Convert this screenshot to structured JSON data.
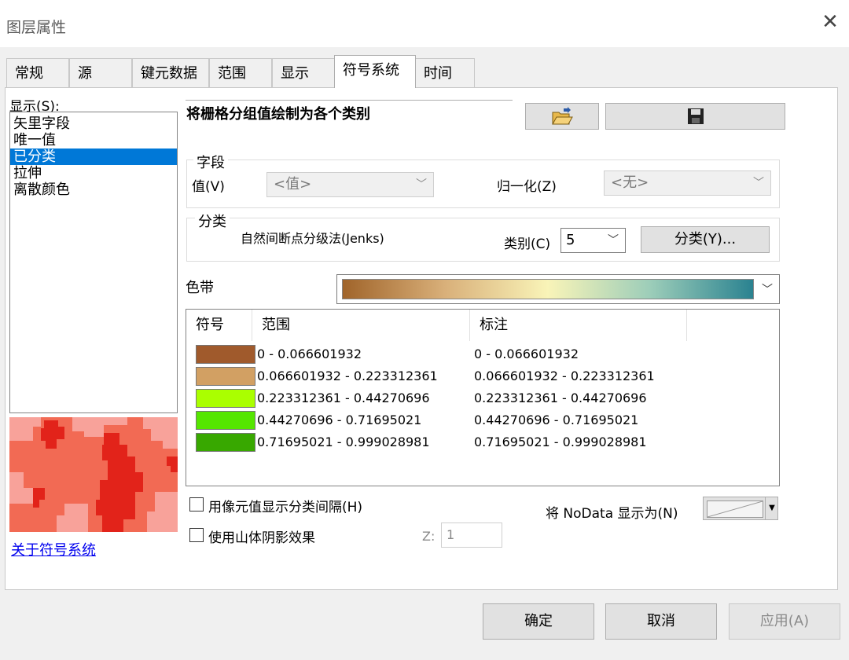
{
  "window": {
    "title": "图层属性"
  },
  "tabs": [
    {
      "label": "常规"
    },
    {
      "label": "源"
    },
    {
      "label": "键元数据"
    },
    {
      "label": "范围"
    },
    {
      "label": "显示"
    },
    {
      "label": "符号系统"
    },
    {
      "label": "时间"
    }
  ],
  "left": {
    "show_label": "显示(S):",
    "items": [
      {
        "label": "矢里字段"
      },
      {
        "label": "唯一值"
      },
      {
        "label": "已分类"
      },
      {
        "label": "拉伸"
      },
      {
        "label": "离散颜色"
      }
    ],
    "selected_index": 2,
    "about_link": "关于符号系统"
  },
  "main": {
    "heading": "将栅格分组值绘制为各个类别",
    "open_icon": "folder-open-icon",
    "save_icon": "floppy-disk-icon",
    "field_group": {
      "title": "字段",
      "value_label": "值(V)",
      "value_selected": "<值>",
      "normalize_label": "归一化(Z)",
      "normalize_selected": "<无>"
    },
    "classify_group": {
      "title": "分类",
      "method": "自然间断点分级法(Jenks)",
      "classes_label": "类别(C)",
      "classes_value": "5",
      "classify_button": "分类(Y)..."
    },
    "color_ramp": {
      "label": "色带",
      "colors": [
        "#a0642a",
        "#d9b07a",
        "#f9f4b8",
        "#9ccdb9",
        "#2a8290"
      ]
    },
    "table": {
      "headers": [
        "符号",
        "范围",
        "标注"
      ],
      "rows": [
        {
          "color": "#a05a2c",
          "range": "0 - 0.066601932",
          "label": "0 - 0.066601932"
        },
        {
          "color": "#d2a063",
          "range": "0.066601932 - 0.223312361",
          "label": "0.066601932 - 0.223312361"
        },
        {
          "color": "#aaff00",
          "range": "0.223312361 - 0.44270696",
          "label": "0.223312361 - 0.44270696"
        },
        {
          "color": "#55e600",
          "range": "0.44270696 - 0.71695021",
          "label": "0.44270696 - 0.71695021"
        },
        {
          "color": "#38a800",
          "range": "0.71695021 - 0.999028981",
          "label": "0.71695021 - 0.999028981"
        }
      ]
    },
    "show_interval_label": "用像元值显示分类间隔(H)",
    "nodata_label": "将 NoData 显示为(N)",
    "hillshade_label": "使用山体阴影效果",
    "z_label": "Z:",
    "z_value": "1"
  },
  "footer": {
    "ok": "确定",
    "cancel": "取消",
    "apply": "应用(A)"
  },
  "preview_colors": {
    "dark": "#e2231a",
    "mid": "#f26a54",
    "light": "#f8a29a"
  }
}
